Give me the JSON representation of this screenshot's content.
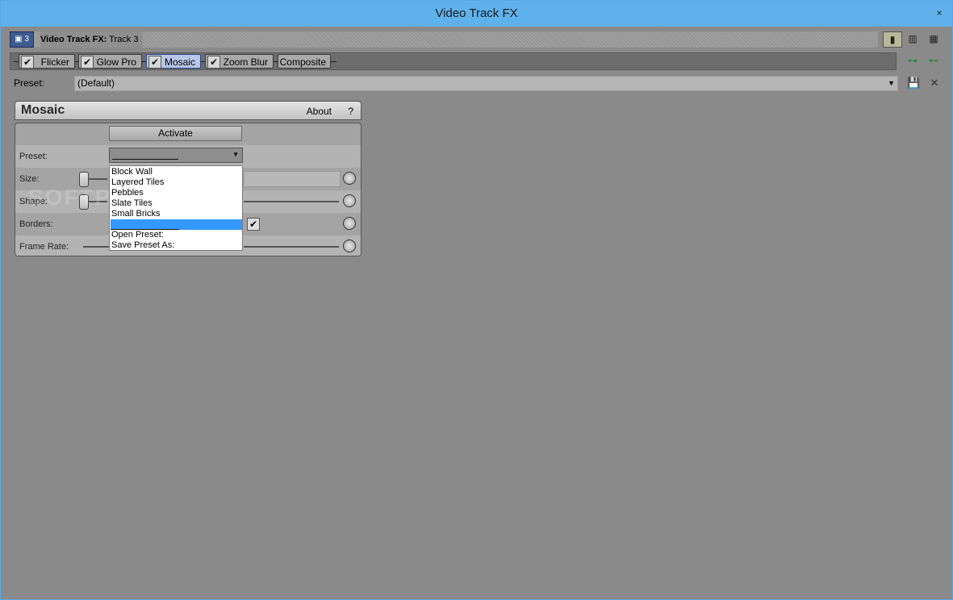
{
  "window": {
    "title": "Video Track FX",
    "close": "×"
  },
  "header": {
    "track_badge": "▣ 3",
    "title_prefix": "Video Track FX:",
    "title_track": "Track 3",
    "view_icons": [
      "▮",
      "▥",
      "▦"
    ]
  },
  "chain": {
    "plugins": [
      {
        "label": "Flicker",
        "checked": true
      },
      {
        "label": "Glow Pro",
        "checked": true
      },
      {
        "label": "Mosaic",
        "checked": true,
        "active": true
      },
      {
        "label": "Zoom Blur",
        "checked": true
      },
      {
        "label": "Composite",
        "checked": false
      }
    ],
    "check_glyph": "✔",
    "add_icon": "⊶",
    "remove_icon": "⊷"
  },
  "preset_bar": {
    "label": "Preset:",
    "value": "(Default)",
    "arrow": "▼",
    "save_icon": "💾",
    "delete_icon": "✕"
  },
  "plugin": {
    "name": "Mosaic",
    "about": "About",
    "help": "?",
    "activate": "Activate",
    "rows": {
      "preset": "Preset:",
      "size": "Size:",
      "shape": "Shape:",
      "borders": "Borders:",
      "frame_rate": "Frame Rate:"
    },
    "dropdown_arrow": "▼",
    "borders_checked": "✔"
  },
  "dropdown": {
    "items": [
      "Block Wall",
      "Layered Tiles",
      "Pebbles",
      "Slate Tiles",
      "Small Bricks"
    ],
    "open_preset": "Open Preset:",
    "save_preset_as": "Save Preset As:"
  },
  "watermark": "SOFTPEDIA"
}
